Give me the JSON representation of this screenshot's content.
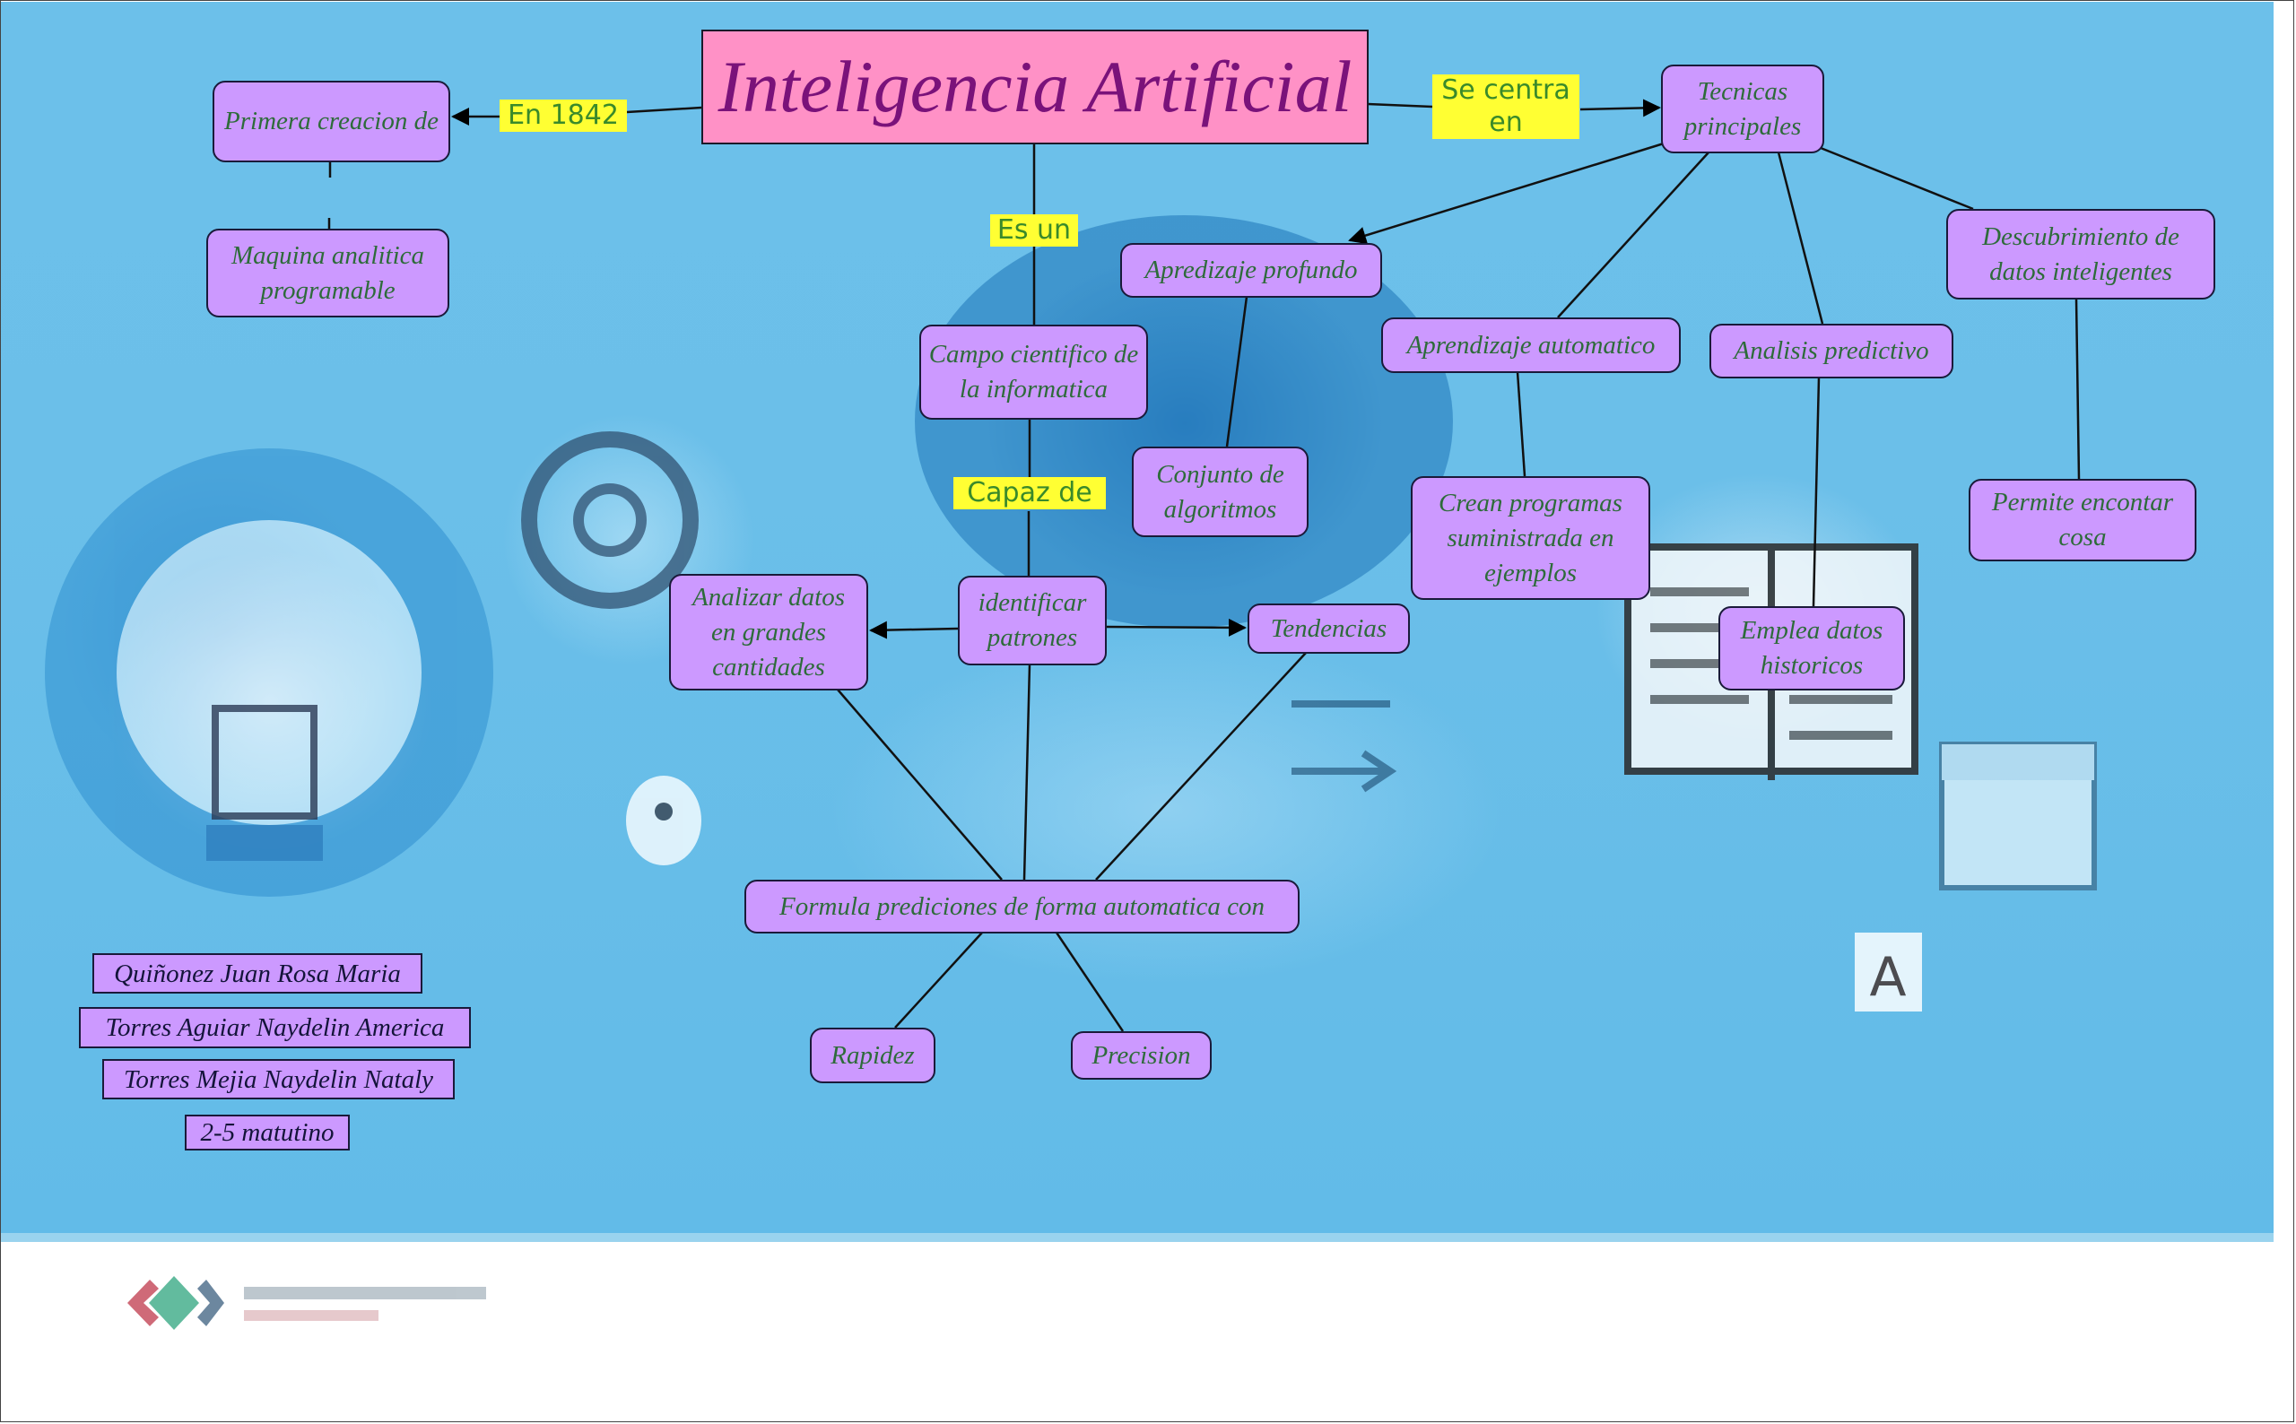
{
  "title": "Inteligencia Artificial",
  "link_labels": {
    "en_1842": "En 1842",
    "se_centra_en": "Se centra en",
    "es_un": "Es un",
    "capaz_de": "Capaz de"
  },
  "nodes": {
    "primera_creacion": "Primera creacion de",
    "maquina_analitica": "Maquina analitica programable",
    "tecnicas_principales": "Tecnicas principales",
    "apredizaje_profundo": "Apredizaje profundo",
    "descubrimiento": "Descubrimiento de datos inteligentes",
    "campo_cientifico": "Campo cientifico de la informatica",
    "aprendizaje_automatico": "Aprendizaje automatico",
    "analisis_predictivo": "Analisis predictivo",
    "conjunto_algoritmos": "Conjunto de algoritmos",
    "crean_programas": "Crean programas suministrada en ejemplos",
    "permite_encontar": "Permite encontar cosa",
    "analizar_datos": "Analizar datos en grandes cantidades",
    "identificar_patrones": "identificar patrones",
    "tendencias": "Tendencias",
    "emplea_datos": "Emplea datos historicos",
    "formula_predicciones": "Formula prediciones de forma automatica con",
    "rapidez": "Rapidez",
    "precision": "Precision"
  },
  "authors": [
    "Quiñonez Juan Rosa Maria",
    "Torres Aguiar Naydelin America",
    "Torres Mejia Naydelin Nataly",
    "2-5 matutino"
  ],
  "colors": {
    "background": "#6bbfe9",
    "title_fill": "#ff91c6",
    "title_text": "#7a127a",
    "node_fill": "#cc99ff",
    "node_text": "#2e6b3a",
    "label_fill": "#ffff33",
    "label_text": "#3a8a2a"
  }
}
